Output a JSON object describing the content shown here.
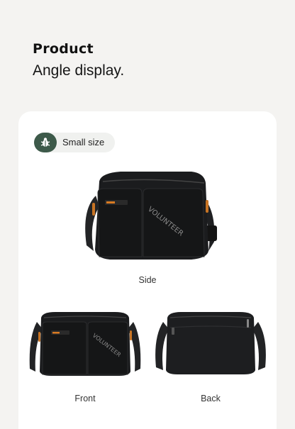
{
  "header": {
    "title": "Product",
    "subtitle": "Angle display."
  },
  "size_tag": {
    "label": "Small size",
    "icon": "bug-icon",
    "accent_color": "#3d5a4a"
  },
  "views": [
    {
      "caption": "Side",
      "brand_text": "VOLUNTEER"
    },
    {
      "caption": "Front",
      "brand_text": "VOLUNTEER"
    },
    {
      "caption": "Back"
    }
  ],
  "colors": {
    "background": "#f4f3f1",
    "card": "#ffffff",
    "bag": "#1b1c1e"
  }
}
